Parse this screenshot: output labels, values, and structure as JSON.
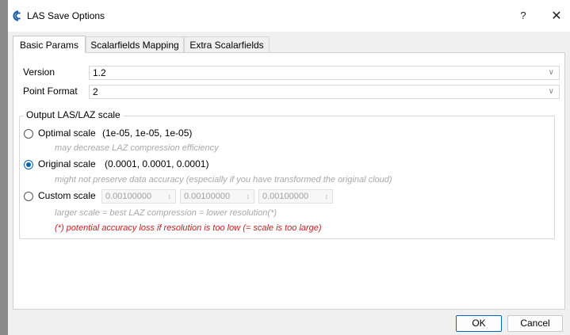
{
  "window": {
    "title": "LAS Save Options",
    "help_glyph": "?",
    "close_glyph": "✕"
  },
  "tabs": [
    {
      "label": "Basic Params",
      "active": true
    },
    {
      "label": "Scalarfields Mapping",
      "active": false
    },
    {
      "label": "Extra Scalarfields",
      "active": false
    }
  ],
  "basic": {
    "version_label": "Version",
    "version_value": "1.2",
    "point_format_label": "Point Format",
    "point_format_value": "2"
  },
  "scale_group": {
    "title": "Output LAS/LAZ scale",
    "optimal": {
      "label": "Optimal scale",
      "values": "(1e-05, 1e-05, 1e-05)",
      "hint": "may decrease LAZ compression efficiency",
      "checked": false
    },
    "original": {
      "label": "Original scale",
      "values": "(0.0001, 0.0001, 0.0001)",
      "hint": "might not preserve data accuracy (especially if you have transformed the original cloud)",
      "checked": true
    },
    "custom": {
      "label": "Custom scale",
      "x": "0.00100000",
      "y": "0.00100000",
      "z": "0.00100000",
      "hint": "larger scale = best LAZ compression = lower resolution(*)",
      "warning": "(*) potential accuracy loss if resolution is too low (= scale is too large)",
      "checked": false
    }
  },
  "buttons": {
    "ok": "OK",
    "cancel": "Cancel"
  },
  "colors": {
    "accent": "#0063b1",
    "warning": "#c02020",
    "hint": "#a8a8a8"
  }
}
